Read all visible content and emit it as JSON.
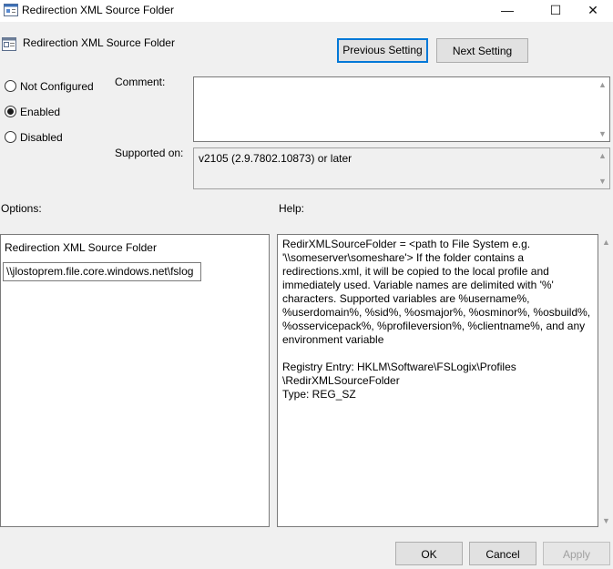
{
  "window": {
    "title": "Redirection XML Source Folder",
    "minimize_glyph": "—",
    "maximize_glyph": "☐",
    "close_glyph": "✕"
  },
  "header": {
    "setting_name": "Redirection XML Source Folder",
    "previous_label": "Previous Setting",
    "next_label": "Next Setting"
  },
  "state": {
    "options": [
      {
        "label": "Not Configured",
        "checked": false
      },
      {
        "label": "Enabled",
        "checked": true
      },
      {
        "label": "Disabled",
        "checked": false
      }
    ]
  },
  "comment": {
    "label": "Comment:",
    "value": ""
  },
  "supported": {
    "label": "Supported on:",
    "value": "v2105 (2.9.7802.10873) or later"
  },
  "options_section": {
    "label": "Options:",
    "field_label": "Redirection XML Source Folder",
    "field_value": "\\\\jlostoprem.file.core.windows.net\\fslog"
  },
  "help_section": {
    "label": "Help:",
    "paragraph1": "RedirXMLSourceFolder = <path to File System e.g. '\\\\someserver\\someshare'> If the folder contains a redirections.xml, it will be copied to the local profile and immediately used. Variable names are delimited with '%' characters. Supported variables are %username%, %userdomain%, %sid%, %osmajor%, %osminor%, %osbuild%, %osservicepack%, %profileversion%, %clientname%, and any environment variable",
    "registry_line1": "Registry Entry:  HKLM\\Software\\FSLogix\\Profiles",
    "registry_line2": "\\RedirXMLSourceFolder",
    "type_line": "Type:  REG_SZ"
  },
  "footer": {
    "ok_label": "OK",
    "cancel_label": "Cancel",
    "apply_label": "Apply"
  },
  "icons": {
    "app": "policy-setting-icon",
    "scroll_up": "▲",
    "scroll_down": "▼"
  },
  "colors": {
    "focus_border": "#0078d7",
    "disabled_text": "#a0a0a0"
  }
}
